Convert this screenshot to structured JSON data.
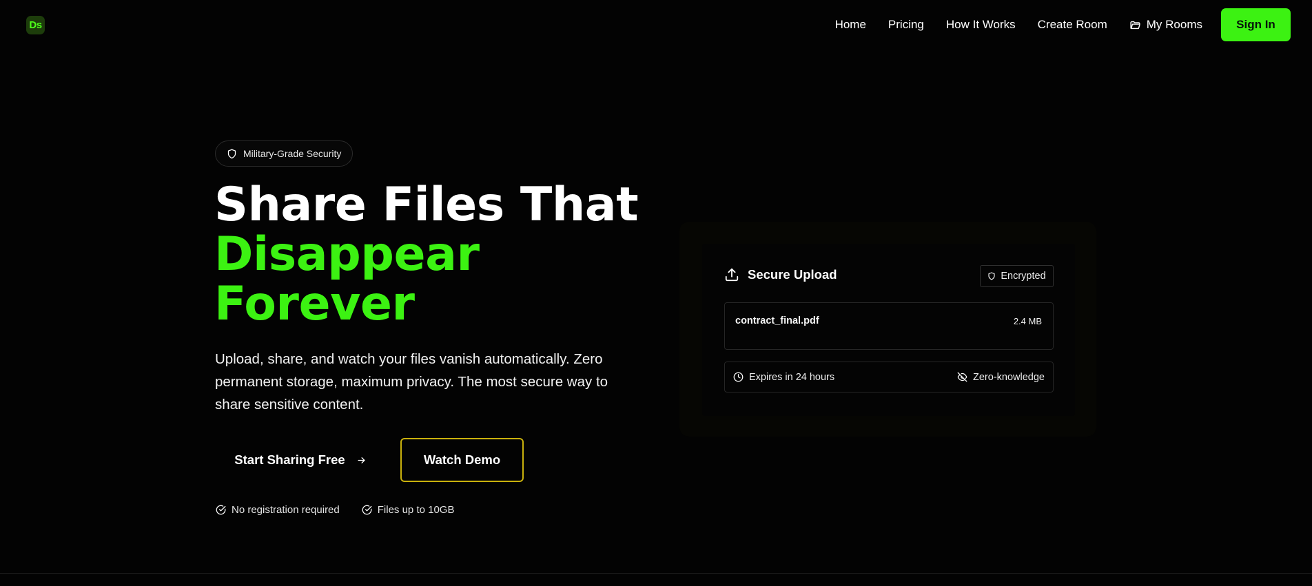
{
  "nav": {
    "logo_text": "Ds",
    "links": [
      {
        "label": "Home"
      },
      {
        "label": "Pricing"
      },
      {
        "label": "How It Works"
      },
      {
        "label": "Create Room"
      },
      {
        "label": "My Rooms",
        "icon": "folder-icon"
      }
    ],
    "signin_label": "Sign In"
  },
  "hero": {
    "badge_label": "Military-Grade Security",
    "badge_icon": "shield-icon",
    "headline_line1": "Share Files That",
    "headline_line2": "Disappear",
    "headline_line3": "Forever",
    "subtitle": "Upload, share, and watch your files vanish automatically. Zero permanent storage, maximum privacy. The most secure way to share sensitive content.",
    "primary_cta": "Start Sharing Free",
    "secondary_cta": "Watch Demo",
    "features": [
      {
        "label": "No registration required",
        "icon": "check-circle-icon"
      },
      {
        "label": "Files up to 10GB",
        "icon": "check-circle-icon"
      }
    ]
  },
  "upload_card": {
    "title": "Secure Upload",
    "title_icon": "upload-icon",
    "status_badge": "Encrypted",
    "file": {
      "name": "contract_final.pdf",
      "size": "2.4 MB"
    },
    "expires": "Expires in 24 hours",
    "privacy": "Zero-knowledge"
  },
  "colors": {
    "background": "#030303",
    "accent_green": "#3cf212",
    "demo_border": "#c9b10c",
    "text": "#ffffff"
  }
}
